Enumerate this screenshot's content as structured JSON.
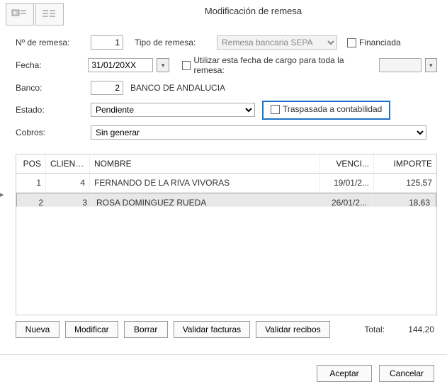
{
  "title": "Modificación de remesa",
  "labels": {
    "num_remesa": "Nº de remesa:",
    "tipo_remesa": "Tipo de remesa:",
    "financiada": "Financiada",
    "fecha": "Fecha:",
    "usar_fecha": "Utilizar esta fecha de cargo para toda la remesa:",
    "banco": "Banco:",
    "estado": "Estado:",
    "traspasada": "Traspasada a contabilidad",
    "cobros": "Cobros:"
  },
  "values": {
    "num_remesa": "1",
    "tipo_remesa": "Remesa bancaria SEPA",
    "fecha": "31/01/20XX",
    "banco_num": "2",
    "banco_nombre": "BANCO DE ANDALUCIA",
    "estado": "Pendiente",
    "cobros": "Sin generar"
  },
  "table": {
    "headers": {
      "pos": "POS",
      "cliente": "CLIENTE",
      "nombre": "NOMBRE",
      "venci": "VENCI...",
      "importe": "IMPORTE"
    },
    "rows": [
      {
        "pos": "1",
        "cliente": "4",
        "nombre": "FERNANDO DE LA RIVA VIVORAS",
        "venci": "19/01/2...",
        "importe": "125,57",
        "selected": false
      },
      {
        "pos": "2",
        "cliente": "3",
        "nombre": "ROSA DOMINGUEZ RUEDA",
        "venci": "26/01/2...",
        "importe": "18,63",
        "selected": true
      }
    ]
  },
  "buttons": {
    "nueva": "Nueva",
    "modificar": "Modificar",
    "borrar": "Borrar",
    "validar_facturas": "Validar facturas",
    "validar_recibos": "Validar recibos",
    "total_lbl": "Total:",
    "total_val": "144,20",
    "aceptar": "Aceptar",
    "cancelar": "Cancelar"
  }
}
